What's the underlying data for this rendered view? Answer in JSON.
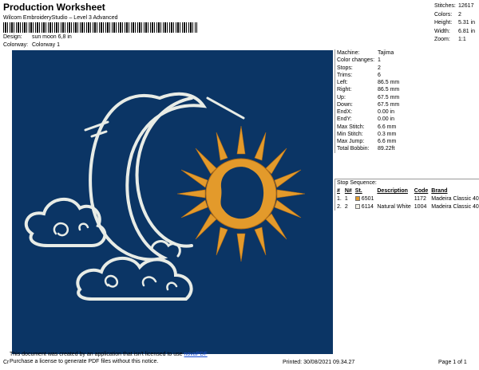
{
  "header": {
    "title": "Production Worksheet",
    "subtitle": "Wilcom EmbroideryStudio – Level 3 Advanced"
  },
  "design_meta": {
    "design_label": "Design:",
    "design_value": "sun moon 6,8 in",
    "colorway_label": "Colorway:",
    "colorway_value": "Colorway 1"
  },
  "summary": [
    {
      "label": "Stitches:",
      "value": "12617"
    },
    {
      "label": "Colors:",
      "value": "2"
    },
    {
      "label": "Height:",
      "value": "5.31 in"
    },
    {
      "label": "Width:",
      "value": "6.81 in"
    },
    {
      "label": "Zoom:",
      "value": "1:1"
    }
  ],
  "machine_info": [
    {
      "label": "Machine:",
      "value": "Tajima"
    },
    {
      "label": "Color changes:",
      "value": "1"
    },
    {
      "label": "Stops:",
      "value": "2"
    },
    {
      "label": "Trims:",
      "value": "6"
    },
    {
      "label": "Left:",
      "value": "86.5 mm"
    },
    {
      "label": "Right:",
      "value": "86.5 mm"
    },
    {
      "label": "Up:",
      "value": "67.5 mm"
    },
    {
      "label": "Down:",
      "value": "67.5 mm"
    },
    {
      "label": "EndX:",
      "value": "0.00 in"
    },
    {
      "label": "EndY:",
      "value": "0.00 in"
    },
    {
      "label": "Max Stitch:",
      "value": "6.6 mm"
    },
    {
      "label": "Min Stitch:",
      "value": "0.3 mm"
    },
    {
      "label": "Max Jump:",
      "value": "6.6 mm"
    },
    {
      "label": "Total Bobbin:",
      "value": "89.22ft"
    }
  ],
  "stop_sequence": {
    "title": "Stop Sequence:",
    "columns": [
      "#",
      "N#",
      "St.",
      "Description",
      "Code",
      "Brand"
    ],
    "rows": [
      {
        "num": "1.",
        "n": "1",
        "color": "#e39a2b",
        "st": "6501",
        "description": "",
        "code": "1172",
        "brand": "Madeira Classic 40"
      },
      {
        "num": "2.",
        "n": "2",
        "color": "#f2f0e6",
        "st": "6114",
        "description": "Natural White",
        "code": "1004",
        "brand": "Madeira Classic 40"
      }
    ]
  },
  "design_colors": {
    "background": "#0b3565",
    "white_thread": "#e8ece6",
    "gold_thread": "#e39a2b"
  },
  "footer": {
    "notice_line1": "This document was created by an application that isn't licensed to use ",
    "notice_link": "novaPDF",
    "notice_line2": "Purchase a license to generate PDF files without this notice.",
    "cr": "Cr",
    "printed": "Printed: 30/08/2021 09.34.27",
    "page": "Page 1 of 1"
  }
}
